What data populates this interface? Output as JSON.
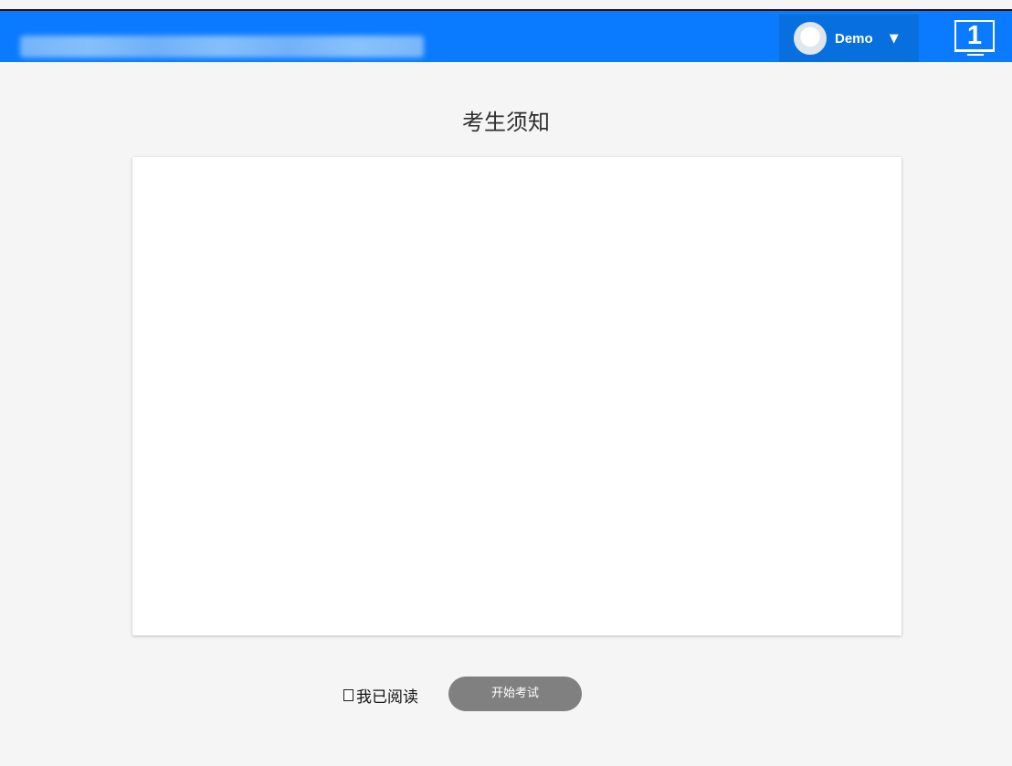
{
  "header": {
    "user_name": "Demo",
    "user_menu_caret": "▼",
    "screen_number": "1"
  },
  "main": {
    "title": "考生须知",
    "read_confirmation": "我已阅读",
    "start_button": "开始考试"
  },
  "icons": {
    "avatar": "avatar-icon",
    "caret": "chevron-down-icon",
    "screen": "monitor-icon",
    "checkbox": "checkbox-icon"
  },
  "colors": {
    "header": "#0a7bff",
    "user_menu": "#086fdf",
    "page_background": "#f5f5f5",
    "button": "#808080"
  }
}
